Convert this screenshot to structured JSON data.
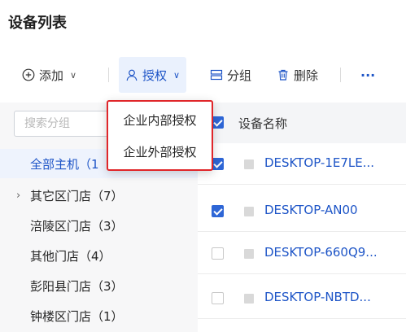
{
  "page": {
    "title": "设备列表"
  },
  "toolbar": {
    "add_label": "添加",
    "authorize_label": "授权",
    "group_label": "分组",
    "delete_label": "删除",
    "more_label": "···"
  },
  "auth_menu": {
    "items": [
      "企业内部授权",
      "企业外部授权"
    ]
  },
  "sidebar": {
    "search_placeholder": "搜索分组",
    "items": [
      {
        "label": "全部主机（1",
        "selected": true
      },
      {
        "label": "其它区门店（7）",
        "expandable": true
      },
      {
        "label": "涪陵区门店（3）"
      },
      {
        "label": "其他门店（4）"
      },
      {
        "label": "彭阳县门店（3）"
      },
      {
        "label": "钟楼区门店（1）"
      }
    ]
  },
  "table": {
    "column_name": "设备名称",
    "rows": [
      {
        "name": "DESKTOP-1E7LE...",
        "checked": true
      },
      {
        "name": "DESKTOP-AN00",
        "checked": true
      },
      {
        "name": "DESKTOP-660Q9...",
        "checked": false
      },
      {
        "name": "DESKTOP-NBTD...",
        "checked": false
      }
    ]
  },
  "colors": {
    "accent": "#1e55c7",
    "highlight_border": "#e0262a",
    "checkbox_checked": "#2e66d6"
  }
}
